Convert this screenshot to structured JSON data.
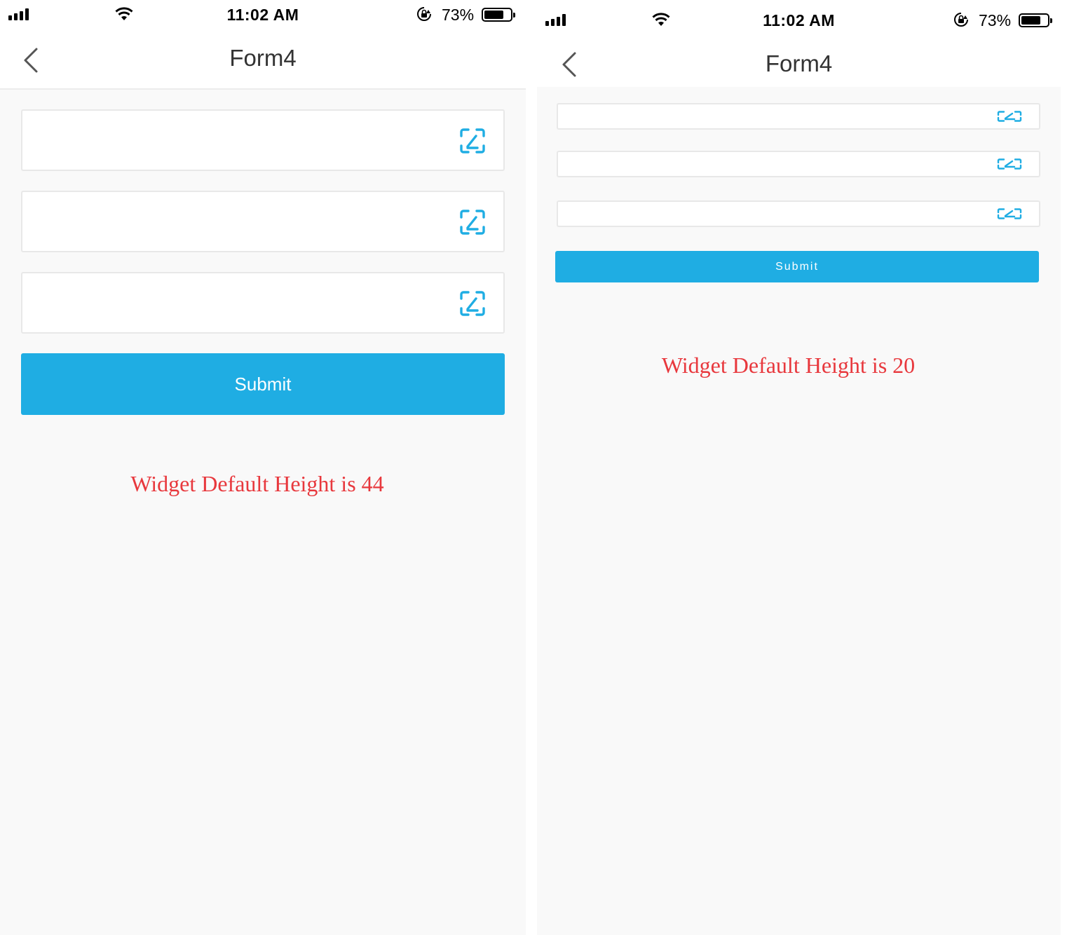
{
  "left_screen": {
    "status": {
      "time": "11:02 AM",
      "battery": "73%"
    },
    "nav": {
      "title": "Form4"
    },
    "fields": [
      {
        "value": ""
      },
      {
        "value": ""
      },
      {
        "value": ""
      }
    ],
    "submit_label": "Submit",
    "caption": "Widget Default Height is 44"
  },
  "right_screen": {
    "status": {
      "time": "11:02 AM",
      "battery": "73%"
    },
    "nav": {
      "title": "Form4"
    },
    "fields": [
      {
        "value": ""
      },
      {
        "value": ""
      },
      {
        "value": ""
      }
    ],
    "submit_label": "Submit",
    "caption": "Widget Default Height is 20"
  },
  "colors": {
    "accent": "#1fade3",
    "caption": "#e8383d",
    "background": "#f9f9f9"
  },
  "icons": [
    "signal-icon",
    "wifi-icon",
    "orientation-lock-icon",
    "battery-icon",
    "back-chevron-icon",
    "edit-icon"
  ]
}
